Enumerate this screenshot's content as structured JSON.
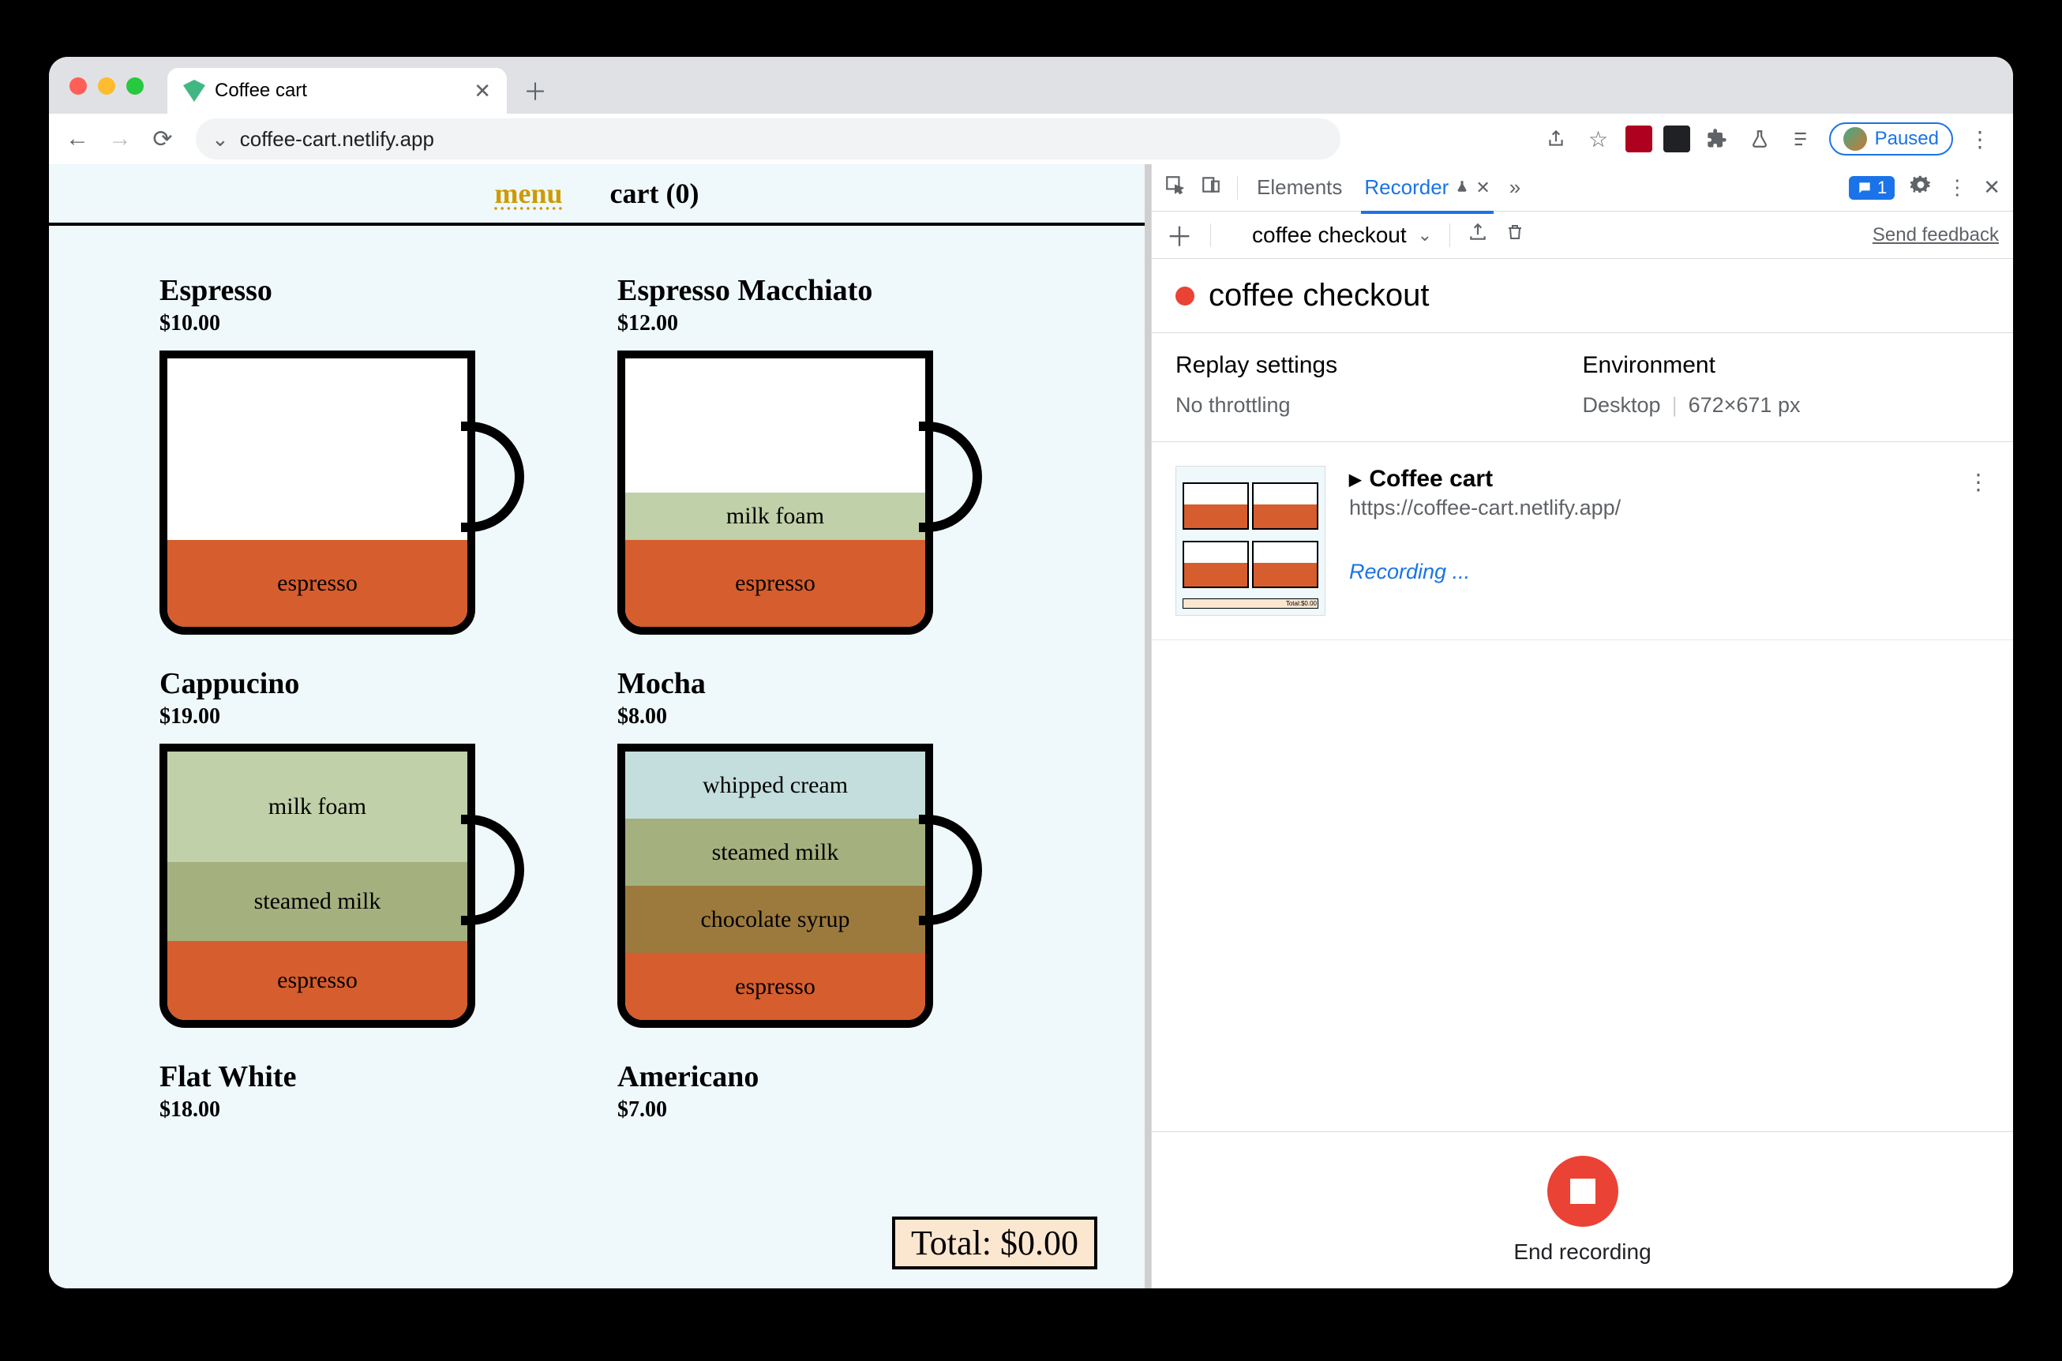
{
  "browser": {
    "tab_title": "Coffee cart",
    "url": "coffee-cart.netlify.app",
    "paused_label": "Paused"
  },
  "page": {
    "nav": {
      "menu": "menu",
      "cart": "cart (0)"
    },
    "total_label": "Total: $0.00",
    "products": [
      {
        "name": "Espresso",
        "price": "$10.00"
      },
      {
        "name": "Espresso Macchiato",
        "price": "$12.00"
      },
      {
        "name": "Cappucino",
        "price": "$19.00"
      },
      {
        "name": "Mocha",
        "price": "$8.00"
      },
      {
        "name": "Flat White",
        "price": "$18.00"
      },
      {
        "name": "Americano",
        "price": "$7.00"
      }
    ],
    "layers": {
      "espresso": "espresso",
      "milk_foam": "milk foam",
      "steamed_milk": "steamed milk",
      "chocolate_syrup": "chocolate syrup",
      "whipped_cream": "whipped cream"
    }
  },
  "devtools": {
    "tabs": {
      "elements": "Elements",
      "recorder": "Recorder"
    },
    "issues_count": "1",
    "subbar": {
      "recording_name": "coffee checkout",
      "feedback": "Send feedback"
    },
    "title": "coffee checkout",
    "settings": {
      "replay_heading": "Replay settings",
      "replay_value": "No throttling",
      "env_heading": "Environment",
      "env_device": "Desktop",
      "env_size": "672×671 px"
    },
    "step": {
      "title": "Coffee cart",
      "url": "https://coffee-cart.netlify.app/",
      "recording": "Recording ..."
    },
    "footer_label": "End recording"
  }
}
